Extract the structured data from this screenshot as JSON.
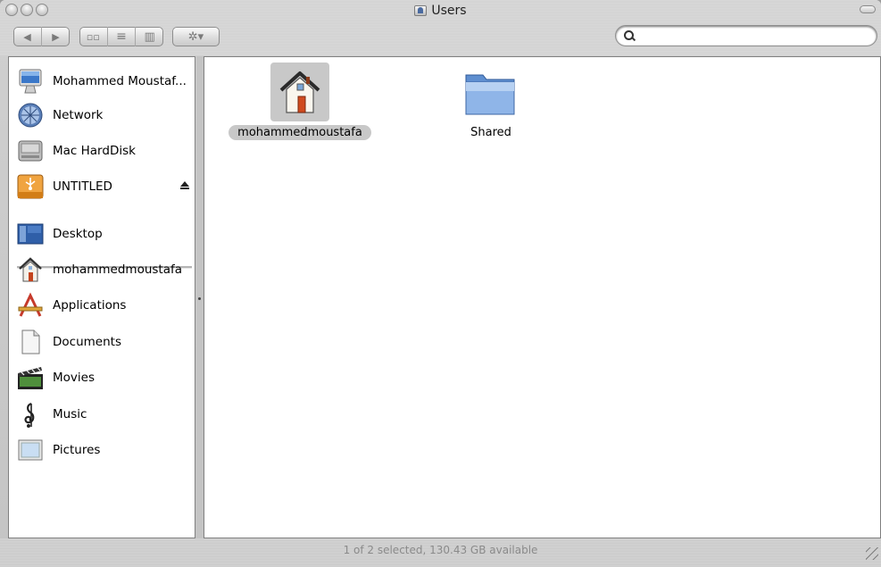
{
  "window": {
    "title": "Users"
  },
  "toolbar": {
    "back_label": "◀",
    "forward_label": "▶",
    "view_icon_glyph": "▫▫",
    "view_list_glyph": "≡",
    "view_column_glyph": "▥",
    "action_glyph": "✲▾",
    "search_value": ""
  },
  "sidebar": {
    "devices": [
      {
        "label": "Mohammed Moustaf...",
        "icon": "computer-icon"
      },
      {
        "label": "Network",
        "icon": "network-globe-icon"
      },
      {
        "label": "Mac HardDisk",
        "icon": "hard-disk-icon"
      },
      {
        "label": "UNTITLED",
        "icon": "usb-drive-icon"
      }
    ],
    "places": [
      {
        "label": "Desktop",
        "icon": "desktop-icon"
      },
      {
        "label": "mohammedmoustafa",
        "icon": "home-icon"
      },
      {
        "label": "Applications",
        "icon": "applications-icon"
      },
      {
        "label": "Documents",
        "icon": "documents-icon"
      },
      {
        "label": "Movies",
        "icon": "movies-icon"
      },
      {
        "label": "Music",
        "icon": "music-icon"
      },
      {
        "label": "Pictures",
        "icon": "pictures-icon"
      }
    ]
  },
  "content": {
    "items": [
      {
        "label": "mohammedmoustafa",
        "icon": "home-folder-icon",
        "selected": true
      },
      {
        "label": "Shared",
        "icon": "folder-icon",
        "selected": false
      }
    ]
  },
  "status": {
    "text": "1 of 2 selected, 130.43 GB available"
  },
  "colors": {
    "selection": "#c8c8c8",
    "folder_blue": "#6f9ad6"
  }
}
